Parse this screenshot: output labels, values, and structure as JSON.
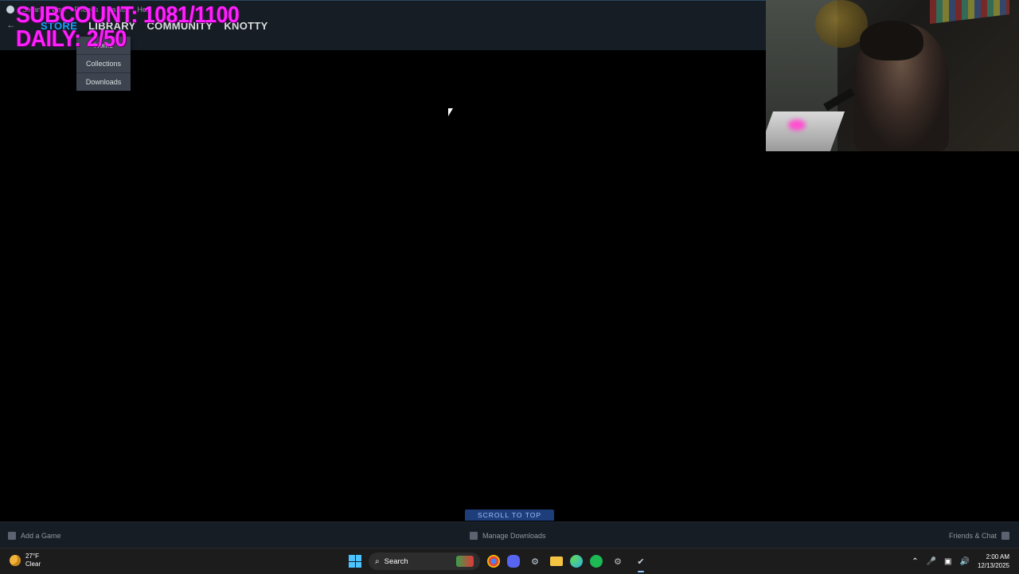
{
  "overlay": {
    "subcount": "SUBCOUNT: 1081/1100",
    "daily": "DAILY: 2/50"
  },
  "steam": {
    "menu": [
      "Steam",
      "View",
      "Friends",
      "Games",
      "Help"
    ],
    "nav_tabs": [
      "STORE",
      "LIBRARY",
      "COMMUNITY",
      "KNOTTY"
    ],
    "active_tab": "STORE",
    "library_dropdown": [
      "Home",
      "Collections",
      "Downloads"
    ],
    "scroll_to_top": "SCROLL TO TOP",
    "bottom": {
      "add_game": "Add a Game",
      "manage_downloads": "Manage Downloads",
      "friends_chat": "Friends & Chat"
    }
  },
  "taskbar": {
    "weather_temp": "27°F",
    "weather_cond": "Clear",
    "search_placeholder": "Search",
    "time": "2:00 AM",
    "date": "12/13/2025",
    "apps": [
      {
        "name": "chrome-icon",
        "color": "#e8453c"
      },
      {
        "name": "discord-icon",
        "color": "#5865f2"
      },
      {
        "name": "steam-icon",
        "color": "#c7d5e0"
      },
      {
        "name": "file-explorer-icon",
        "color": "#f5c342"
      },
      {
        "name": "edge-icon",
        "color": "#2bb3e8"
      },
      {
        "name": "spotify-icon",
        "color": "#1db954"
      },
      {
        "name": "settings-icon",
        "color": "#c0c0c0"
      },
      {
        "name": "steam-active-icon",
        "color": "#c7d5e0"
      }
    ]
  }
}
